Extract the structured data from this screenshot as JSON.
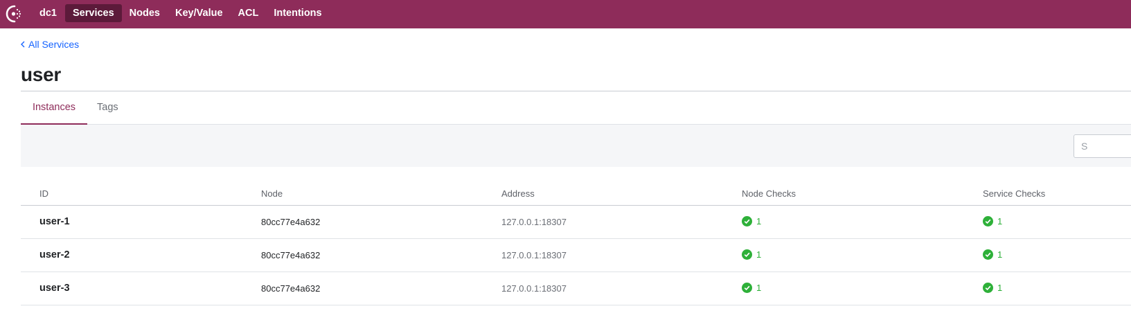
{
  "nav": {
    "items": [
      {
        "label": "dc1"
      },
      {
        "label": "Services"
      },
      {
        "label": "Nodes"
      },
      {
        "label": "Key/Value"
      },
      {
        "label": "ACL"
      },
      {
        "label": "Intentions"
      }
    ],
    "active": "Services"
  },
  "breadcrumb": {
    "label": "All Services"
  },
  "page": {
    "title": "user"
  },
  "tabs": [
    {
      "label": "Instances",
      "active": true
    },
    {
      "label": "Tags",
      "active": false
    }
  ],
  "search": {
    "placeholder": "S"
  },
  "table": {
    "headers": [
      "ID",
      "Node",
      "Address",
      "Node Checks",
      "Service Checks"
    ],
    "rows": [
      {
        "id": "user-1",
        "node": "80cc77e4a632",
        "address": "127.0.0.1:18307",
        "node_checks": "1",
        "service_checks": "1"
      },
      {
        "id": "user-2",
        "node": "80cc77e4a632",
        "address": "127.0.0.1:18307",
        "node_checks": "1",
        "service_checks": "1"
      },
      {
        "id": "user-3",
        "node": "80cc77e4a632",
        "address": "127.0.0.1:18307",
        "node_checks": "1",
        "service_checks": "1"
      }
    ]
  },
  "colors": {
    "brand": "#8e2c5a",
    "passing": "#2eb039",
    "link": "#1563ff"
  }
}
